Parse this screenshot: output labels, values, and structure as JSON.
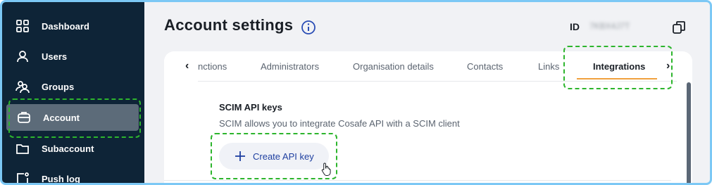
{
  "sidebar": {
    "items": [
      {
        "label": "Dashboard",
        "icon": "grid-icon"
      },
      {
        "label": "Users",
        "icon": "user-icon"
      },
      {
        "label": "Groups",
        "icon": "users-group-icon"
      },
      {
        "label": "Account",
        "icon": "briefcase-icon",
        "active": true
      },
      {
        "label": "Subaccount",
        "icon": "folder-icon"
      },
      {
        "label": "Push log",
        "icon": "push-log-icon"
      }
    ]
  },
  "header": {
    "title": "Account settings",
    "id_label": "ID",
    "id_value": "7KBX4J7T"
  },
  "tabs": {
    "items": [
      "nctions",
      "Administrators",
      "Organisation details",
      "Contacts",
      "Links",
      "Integrations"
    ],
    "active": "Integrations",
    "prev_arrow": "‹",
    "next_arrow": "›"
  },
  "scim": {
    "title": "SCIM API keys",
    "description": "SCIM allows you to integrate Cosafe API with a SCIM client",
    "create_label": "Create API key"
  },
  "colors": {
    "sidebar_bg": "#0e2437",
    "active_item_bg": "#5c6b79",
    "accent_underline": "#f0a13e",
    "link_blue": "#1e3fa0",
    "highlight_green": "#2db52d"
  }
}
